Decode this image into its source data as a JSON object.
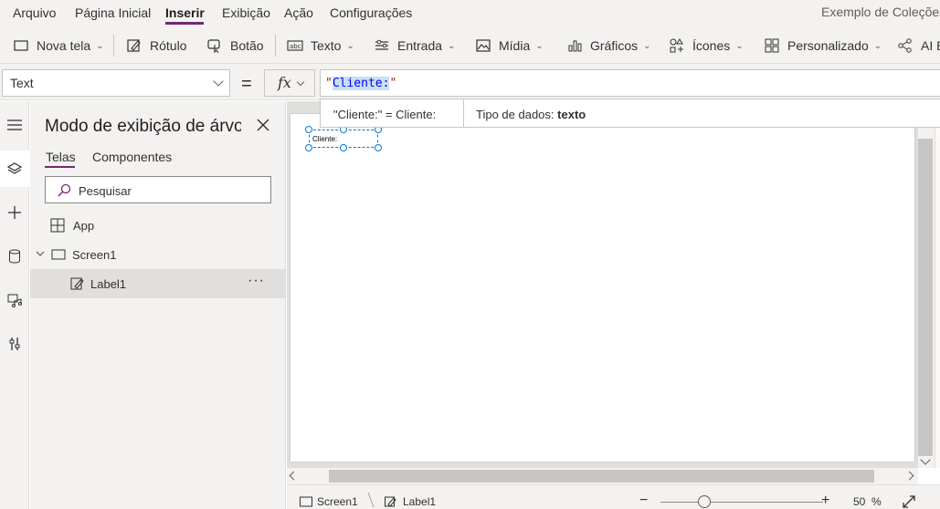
{
  "menu": {
    "items": [
      "Arquivo",
      "Página Inicial",
      "Inserir",
      "Exibição",
      "Ação",
      "Configurações"
    ],
    "active": "Inserir",
    "app_title": "Exemplo de Coleções"
  },
  "ribbon": {
    "new_screen": "Nova tela",
    "label": "Rótulo",
    "button": "Botão",
    "text": "Texto",
    "input": "Entrada",
    "media": "Mídia",
    "charts": "Gráficos",
    "icons": "Ícones",
    "custom": "Personalizado",
    "ai": "AI Builder"
  },
  "formula_bar": {
    "property": "Text",
    "equals": "=",
    "fx": "fx",
    "formula_quote_open": "\"",
    "formula_value": "Cliente:",
    "formula_quote_close": "\"",
    "result_text": "\"Cliente:\"  =  Cliente:",
    "data_type_label": "Tipo de dados:",
    "data_type_value": "texto"
  },
  "tree_view": {
    "title": "Modo de exibição de árvore",
    "tabs": [
      "Telas",
      "Componentes"
    ],
    "active_tab": "Telas",
    "search_placeholder": "Pesquisar",
    "nodes": [
      {
        "label": "App",
        "icon": "app-grid-icon"
      },
      {
        "label": "Screen1",
        "icon": "screen-icon",
        "expanded": true
      },
      {
        "label": "Label1",
        "icon": "label-edit-icon",
        "selected": true,
        "more": "···"
      }
    ]
  },
  "canvas": {
    "label_text": "Cliente:"
  },
  "status_bar": {
    "screen": "Screen1",
    "control": "Label1",
    "zoom_minus": "−",
    "zoom_plus": "+",
    "zoom_value": "50",
    "zoom_unit": "%"
  },
  "colors": {
    "accent": "#742774",
    "selection": "#0078d4",
    "background": "#f3f2f1"
  }
}
